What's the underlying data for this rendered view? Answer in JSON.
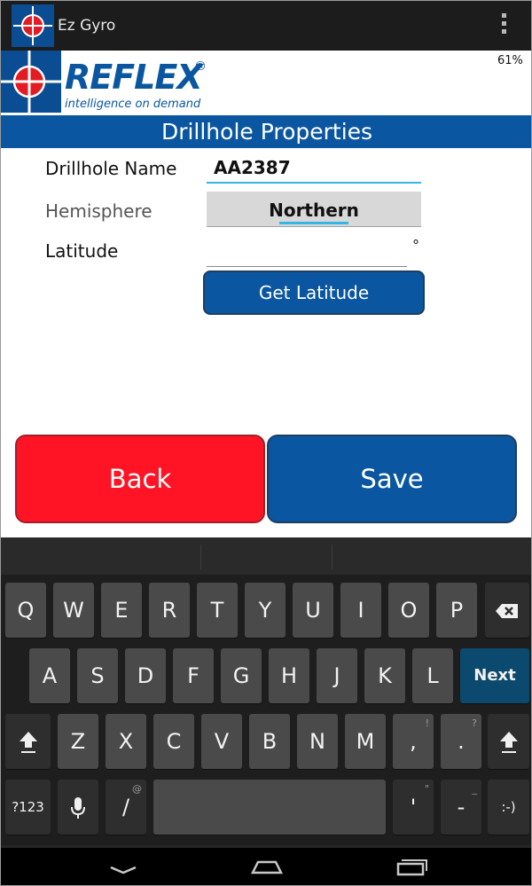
{
  "app": {
    "title": "Ez Gyro",
    "battery": "61%"
  },
  "logo": {
    "brand": "REFLEX",
    "reg": "®",
    "tagline": "intelligence on demand"
  },
  "page_title": "Drillhole Properties",
  "form": {
    "drillhole_name_label": "Drillhole Name",
    "drillhole_name_value": "AA2387",
    "hemisphere_label": "Hemisphere",
    "hemisphere_value": "Northern",
    "latitude_label": "Latitude",
    "latitude_value": "",
    "degree_symbol": "°",
    "get_latitude_button": "Get Latitude"
  },
  "buttons": {
    "back": "Back",
    "save": "Save"
  },
  "colors": {
    "accent": "#0a56a0",
    "back": "#ff1425",
    "focus": "#33b5e5"
  },
  "keyboard": {
    "row1": [
      "Q",
      "W",
      "E",
      "R",
      "T",
      "Y",
      "U",
      "I",
      "O",
      "P"
    ],
    "row2": [
      "A",
      "S",
      "D",
      "F",
      "G",
      "H",
      "J",
      "K",
      "L"
    ],
    "row3": [
      "Z",
      "X",
      "C",
      "V",
      "B",
      "N",
      "M"
    ],
    "next": "Next",
    "sym": "?123",
    "comma": ",",
    "period": ".",
    "comma_alt": "!",
    "period_alt": "?",
    "slash": "/",
    "slash_alt": "@",
    "apostrophe": "'",
    "apostrophe_alt": "\"",
    "dash": "-",
    "dash_alt": "_",
    "smiley": ":-)"
  },
  "icons": [
    "app-logo-icon",
    "overflow-menu-icon",
    "backspace-icon",
    "shift-icon",
    "mic-icon",
    "nav-back-icon",
    "nav-home-icon",
    "nav-recent-icon"
  ]
}
